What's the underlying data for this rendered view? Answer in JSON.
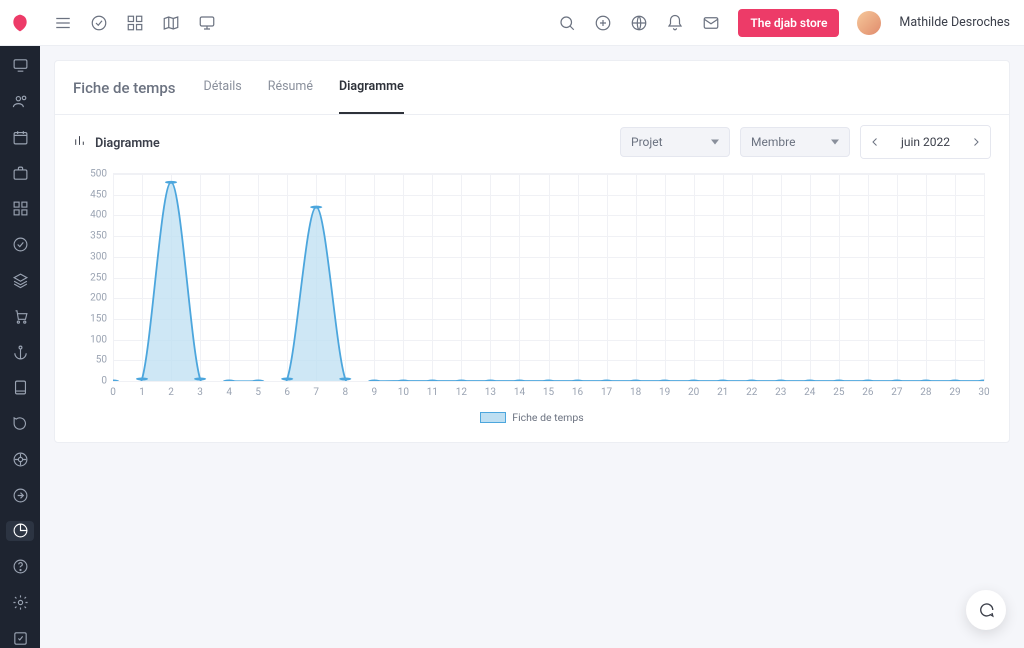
{
  "header": {
    "store_button": "The djab store",
    "user_name": "Mathilde Desroches"
  },
  "page": {
    "title": "Fiche de temps",
    "tabs": [
      "Détails",
      "Résumé",
      "Diagramme"
    ],
    "active_tab": 2
  },
  "panel": {
    "title": "Diagramme",
    "filter_project": "Projet",
    "filter_member": "Membre",
    "date_label": "juin 2022"
  },
  "legend": {
    "label": "Fiche de temps"
  },
  "chart_data": {
    "type": "area",
    "title": "Diagramme",
    "xlabel": "",
    "ylabel": "",
    "ylim": [
      0,
      500
    ],
    "yticks": [
      0,
      50,
      100,
      150,
      200,
      250,
      300,
      350,
      400,
      450,
      500
    ],
    "x": [
      0,
      1,
      2,
      3,
      4,
      5,
      6,
      7,
      8,
      9,
      10,
      11,
      12,
      13,
      14,
      15,
      16,
      17,
      18,
      19,
      20,
      21,
      22,
      23,
      24,
      25,
      26,
      27,
      28,
      29,
      30
    ],
    "series": [
      {
        "name": "Fiche de temps",
        "values": [
          0,
          5,
          480,
          5,
          0,
          0,
          5,
          420,
          5,
          0,
          0,
          0,
          0,
          0,
          0,
          0,
          0,
          0,
          0,
          0,
          0,
          0,
          0,
          0,
          0,
          0,
          0,
          0,
          0,
          0,
          0
        ]
      }
    ]
  }
}
